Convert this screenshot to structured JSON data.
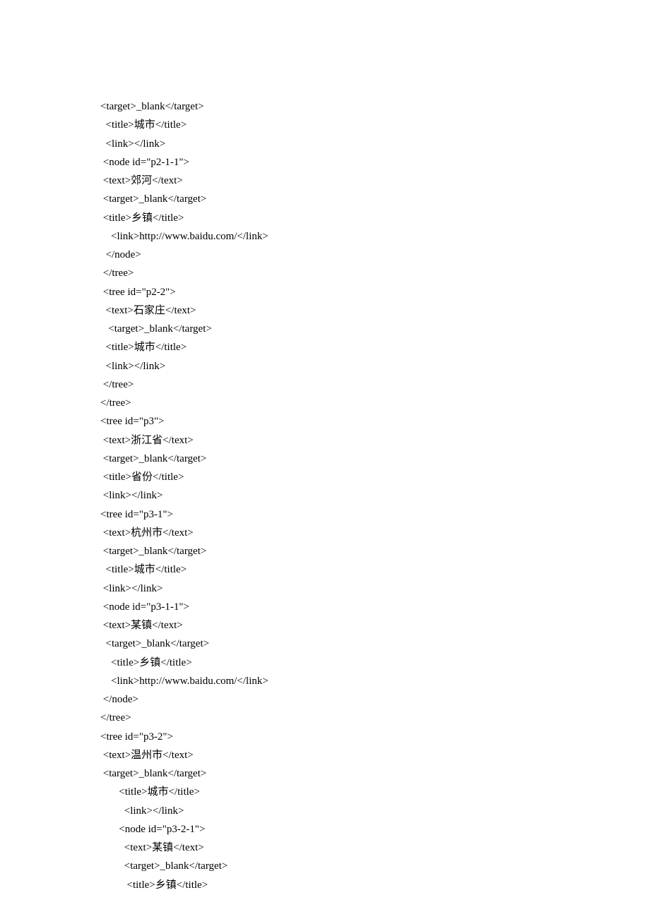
{
  "lines": [
    {
      "indent": 0,
      "text": "<target>_blank</target>"
    },
    {
      "indent": 2,
      "text": "<title>城市</title>"
    },
    {
      "indent": 2,
      "text": "<link></link>"
    },
    {
      "indent": 1,
      "text": "<node id=\"p2-1-1\">"
    },
    {
      "indent": 1,
      "text": "<text>郊河</text>"
    },
    {
      "indent": 1,
      "text": "<target>_blank</target>"
    },
    {
      "indent": 1,
      "text": "<title>乡镇</title>"
    },
    {
      "indent": 4,
      "text": "<link>http://www.baidu.com/</link>"
    },
    {
      "indent": 2,
      "text": "</node>"
    },
    {
      "indent": 1,
      "text": "</tree>"
    },
    {
      "indent": 1,
      "text": "<tree id=\"p2-2\">"
    },
    {
      "indent": 2,
      "text": "<text>石家庄</text>"
    },
    {
      "indent": 3,
      "text": "<target>_blank</target>"
    },
    {
      "indent": 2,
      "text": "<title>城市</title>"
    },
    {
      "indent": 2,
      "text": "<link></link>"
    },
    {
      "indent": 1,
      "text": "</tree>"
    },
    {
      "indent": 0,
      "text": "</tree>"
    },
    {
      "indent": 0,
      "text": "<tree id=\"p3\">"
    },
    {
      "indent": 1,
      "text": "<text>浙江省</text>"
    },
    {
      "indent": 1,
      "text": "<target>_blank</target>"
    },
    {
      "indent": 1,
      "text": "<title>省份</title>"
    },
    {
      "indent": 1,
      "text": "<link></link>"
    },
    {
      "indent": 0,
      "text": "<tree id=\"p3-1\">"
    },
    {
      "indent": 1,
      "text": "<text>杭州市</text>"
    },
    {
      "indent": 1,
      "text": "<target>_blank</target>"
    },
    {
      "indent": 2,
      "text": "<title>城市</title>"
    },
    {
      "indent": 1,
      "text": "<link></link>"
    },
    {
      "indent": 1,
      "text": "<node id=\"p3-1-1\">"
    },
    {
      "indent": 1,
      "text": "<text>某镇</text>"
    },
    {
      "indent": 2,
      "text": "<target>_blank</target>"
    },
    {
      "indent": 4,
      "text": "<title>乡镇</title>"
    },
    {
      "indent": 4,
      "text": "<link>http://www.baidu.com/</link>"
    },
    {
      "indent": 1,
      "text": "</node>"
    },
    {
      "indent": 0,
      "text": "</tree>"
    },
    {
      "indent": 0,
      "text": "<tree id=\"p3-2\">"
    },
    {
      "indent": 1,
      "text": "<text>温州市</text>"
    },
    {
      "indent": 1,
      "text": "<target>_blank</target>"
    },
    {
      "indent": 7,
      "text": "<title>城市</title>"
    },
    {
      "indent": 9,
      "text": "<link></link>"
    },
    {
      "indent": 7,
      "text": "<node id=\"p3-2-1\">"
    },
    {
      "indent": 9,
      "text": "<text>某镇</text>"
    },
    {
      "indent": 9,
      "text": "<target>_blank</target>"
    },
    {
      "indent": 10,
      "text": "<title>乡镇</title>"
    }
  ]
}
